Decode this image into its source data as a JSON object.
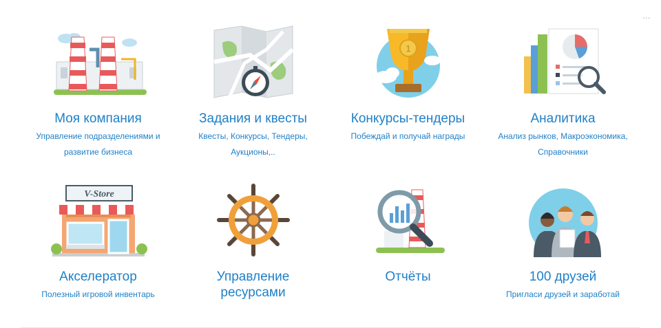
{
  "cards": [
    {
      "title": "Моя компания",
      "desc": "Управление подразделениями и развитие бизнеса"
    },
    {
      "title": "Задания и квесты",
      "desc": "Квесты, Конкурсы, Тендеры, Аукционы,.."
    },
    {
      "title": "Конкурсы-тендеры",
      "desc": "Побеждай и получай награды"
    },
    {
      "title": "Аналитика",
      "desc": "Анализ рынков, Макроэкономика, Справочники"
    },
    {
      "title": "Акселератор",
      "desc": "Полезный игровой инвентарь",
      "store_sign": "V-Store"
    },
    {
      "title": "Управление ресурсами",
      "desc": ""
    },
    {
      "title": "Отчёты",
      "desc": ""
    },
    {
      "title": "100 друзей",
      "desc": "Пригласи друзей и заработай"
    }
  ],
  "menu": {
    "label": "···"
  },
  "colors": {
    "link": "#1f80c7",
    "background": "#ffffff"
  }
}
